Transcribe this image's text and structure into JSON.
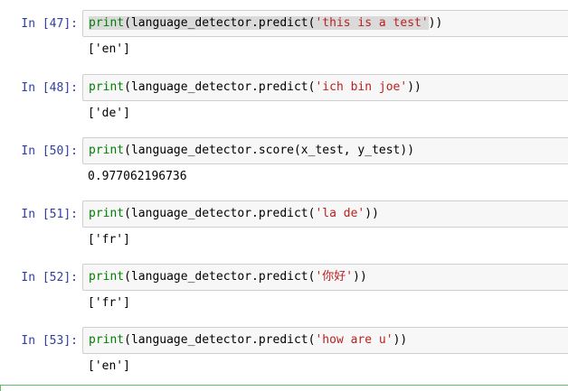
{
  "cells": [
    {
      "prompt": "In [47]:",
      "code_func": "print",
      "code_pre": "(language_detector.predict(",
      "code_str": "'this is a test'",
      "code_post": "))",
      "output": "['en']"
    },
    {
      "prompt": "In [48]:",
      "code_func": "print",
      "code_pre": "(language_detector.predict(",
      "code_str": "'ich bin joe'",
      "code_post": "))",
      "output": "['de']"
    },
    {
      "prompt": "In [50]:",
      "code_func": "print",
      "code_pre": "(language_detector.score(x_test, y_test))",
      "code_str": "",
      "code_post": "",
      "output": "0.977062196736"
    },
    {
      "prompt": "In [51]:",
      "code_func": "print",
      "code_pre": "(language_detector.predict(",
      "code_str": "'la de'",
      "code_post": "))",
      "output": "['fr']"
    },
    {
      "prompt": "In [52]:",
      "code_func": "print",
      "code_pre": "(language_detector.predict(",
      "code_str": "'你好'",
      "code_post": "))",
      "output": "['fr']"
    },
    {
      "prompt": "In [53]:",
      "code_func": "print",
      "code_pre": "(language_detector.predict(",
      "code_str": "'how are u'",
      "code_post": "))",
      "output": "['en']"
    }
  ],
  "colors": {
    "prompt": "#303f9f",
    "keyword": "#008000",
    "string": "#ba2121",
    "input_bg": "#f7f7f7",
    "input_border": "#cfcfcf",
    "selected_cell_border": "#66bb6a"
  }
}
